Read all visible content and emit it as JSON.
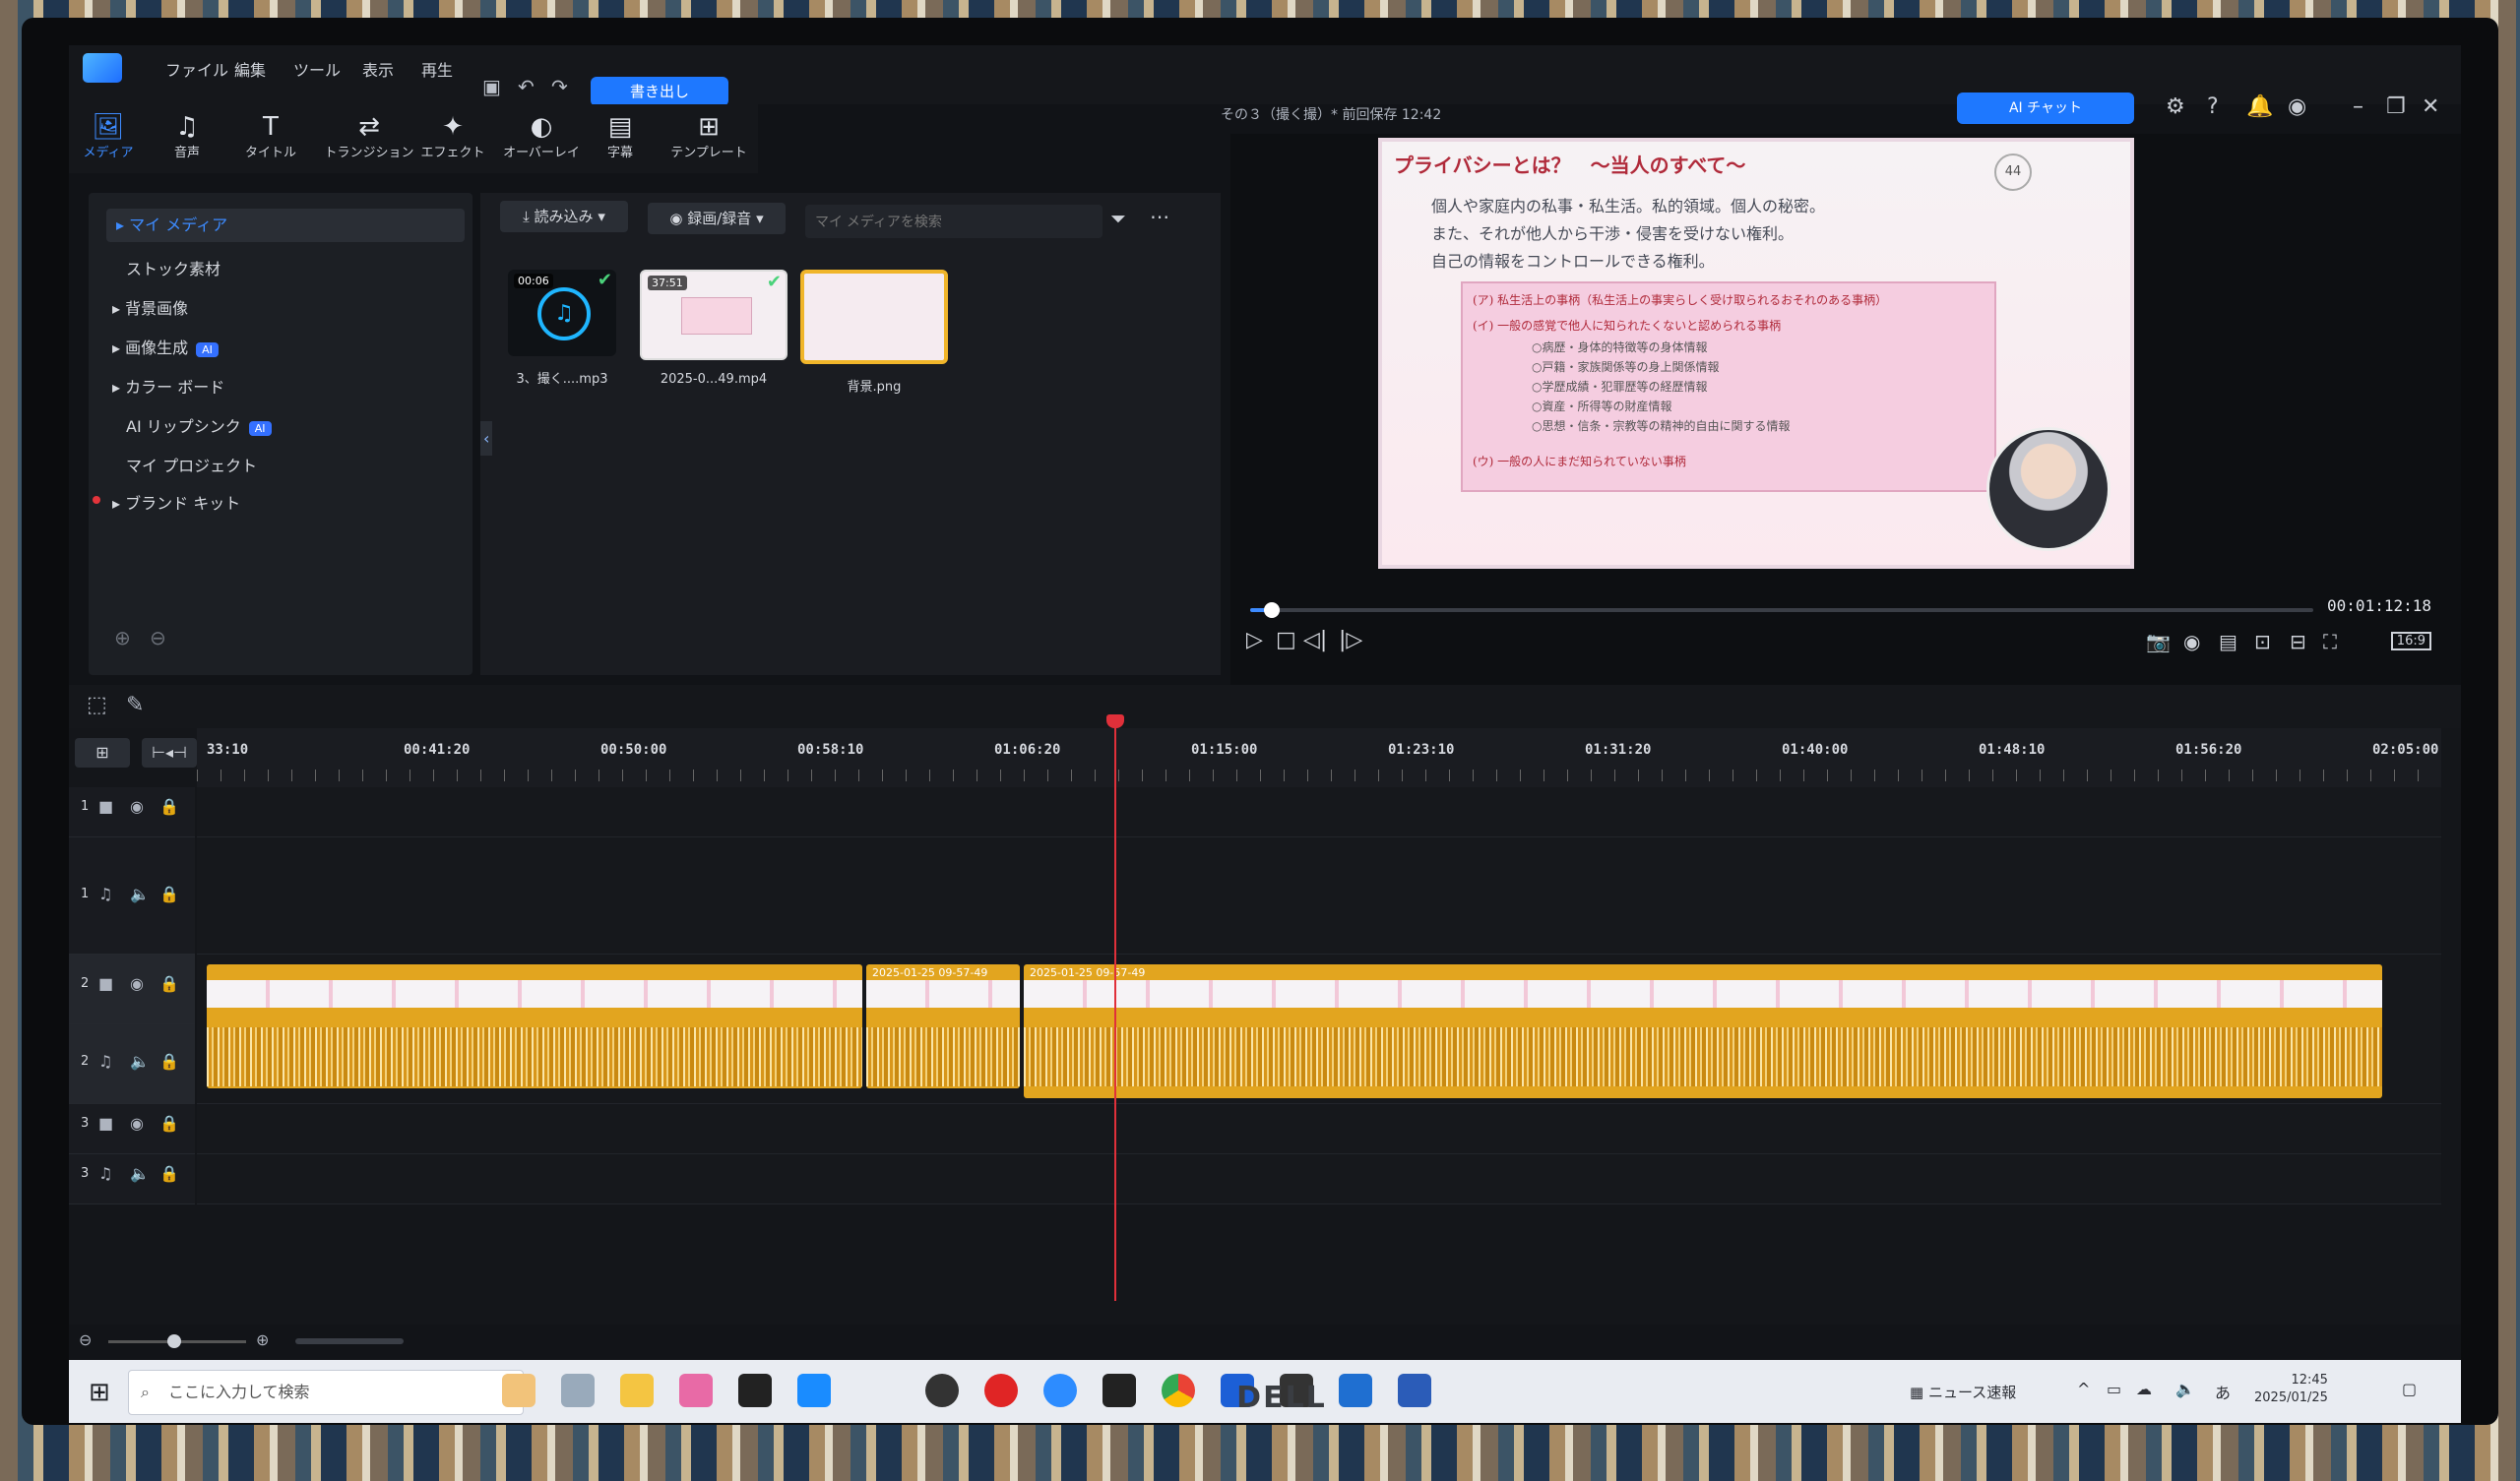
{
  "menu": {
    "items": [
      "ファイル",
      "編集",
      "ツール",
      "表示",
      "再生"
    ],
    "export_label": "書き出し",
    "project_title": "その３（撮く撮）* 前回保存 12:42",
    "ai_chat_label": "AI チャット"
  },
  "tabs": [
    {
      "icon": "🖼",
      "label": "メディア"
    },
    {
      "icon": "♫",
      "label": "音声"
    },
    {
      "icon": "T",
      "label": "タイトル"
    },
    {
      "icon": "⇄",
      "label": "トランジション"
    },
    {
      "icon": "✦",
      "label": "エフェクト"
    },
    {
      "icon": "◐",
      "label": "オーバーレイ"
    },
    {
      "icon": "▤",
      "label": "字幕"
    },
    {
      "icon": "⊞",
      "label": "テンプレート"
    }
  ],
  "library": {
    "items": [
      {
        "label": "マイ メディア",
        "badge": ""
      },
      {
        "label": "ストック素材",
        "badge": ""
      },
      {
        "label": "背景画像",
        "badge": ""
      },
      {
        "label": "画像生成",
        "badge": "AI"
      },
      {
        "label": "カラー ボード",
        "badge": ""
      },
      {
        "label": "AI リップシンク",
        "badge": "AI"
      },
      {
        "label": "マイ プロジェクト",
        "badge": ""
      },
      {
        "label": "ブランド キット",
        "badge": ""
      }
    ]
  },
  "pool": {
    "import_label": "読み込み",
    "record_label": "録画/録音",
    "search_placeholder": "マイ メディアを検索",
    "items": [
      {
        "name": "3、撮く....mp3",
        "duration": "00:06",
        "kind": "audio"
      },
      {
        "name": "2025-0...49.mp4",
        "duration": "37:51",
        "kind": "video"
      },
      {
        "name": "背景.png",
        "duration": "",
        "kind": "image"
      }
    ]
  },
  "preview": {
    "slide_title": "プライバシーとは？　～当人のすべて～",
    "slide_page": "44",
    "slide_lines": [
      "個人や家庭内の私事・私生活。私的領域。個人の秘密。",
      "また、それが他人から干渉・侵害を受けない権利。",
      "自己の情報をコントロールできる権利。"
    ],
    "box_lines": [
      "(ア) 私生活上の事柄（私生活上の事実らしく受け取られるおそれのある事柄）",
      "(イ) 一般の感覚で他人に知られたくないと認められる事柄",
      "○病歴・身体的特徴等の身体情報",
      "○戸籍・家族関係等の身上関係情報",
      "○学歴成績・犯罪歴等の経歴情報",
      "○資産・所得等の財産情報",
      "○思想・信条・宗教等の精神的自由に関する情報",
      "(ウ) 一般の人にまだ知られていない事柄"
    ],
    "timecode": "00:01:12:18",
    "progress": 0.02,
    "ratio_label": "16:9"
  },
  "timeline": {
    "ruler": [
      "33:10",
      "00:41:20",
      "00:50:00",
      "00:58:10",
      "01:06:20",
      "01:15:00",
      "01:23:10",
      "01:31:20",
      "01:40:00",
      "01:48:10",
      "01:56:20",
      "02:05:00"
    ],
    "tracks": [
      {
        "num": "1",
        "type": "video"
      },
      {
        "num": "1",
        "type": "audio"
      },
      {
        "num": "2",
        "type": "video"
      },
      {
        "num": "2",
        "type": "audio"
      },
      {
        "num": "3",
        "type": "video"
      },
      {
        "num": "3",
        "type": "audio"
      }
    ],
    "clips": [
      {
        "label": ""
      },
      {
        "label": "2025-01-25 09-57-49"
      },
      {
        "label": "2025-01-25 09-57-49"
      }
    ]
  },
  "taskbar": {
    "search_placeholder": "ここに入力して検索",
    "news_label": "ニュース速報",
    "ime": "あ",
    "time": "12:45",
    "date": "2025/01/25"
  },
  "monitor_brand": "DELL",
  "colors": {
    "accent": "#1e78ff",
    "clip": "#e2a51f",
    "playhead": "#e0303a"
  }
}
